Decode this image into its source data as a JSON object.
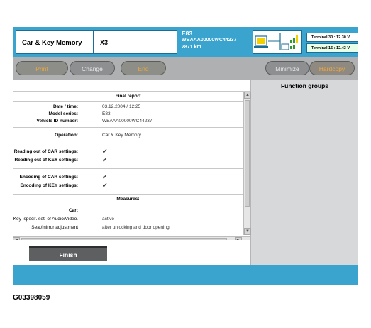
{
  "header": {
    "app_title": "Car & Key Memory",
    "model": "X3",
    "vehicle_series": "E83",
    "vin": "WBAAA00000WC44237",
    "mileage": "2871 km",
    "terminal_30": "Terminal 30 : 12.30 V",
    "terminal_15": "Terminal 15 : 12.43 V"
  },
  "toolbar": {
    "print": "Print",
    "change": "Change",
    "end": "End",
    "minimize": "Minimize",
    "hardcopy": "Hardcopy"
  },
  "function_groups": {
    "title": "Function groups"
  },
  "report": {
    "title": "Final report",
    "info": [
      {
        "label": "Date / time:",
        "value": "03.12.2004 / 12:25"
      },
      {
        "label": "Model series:",
        "value": "E83"
      },
      {
        "label": "Vehicle ID number:",
        "value": "WBAAA00000WC44237"
      }
    ],
    "operation": {
      "label": "Operation:",
      "value": "Car & Key Memory"
    },
    "reading": [
      {
        "label": "Reading out of CAR settings:",
        "value": "✔"
      },
      {
        "label": "Reading out of KEY settings:",
        "value": "✔"
      }
    ],
    "encoding": [
      {
        "label": "Encoding of CAR settings:",
        "value": "✔"
      },
      {
        "label": "Encoding of KEY settings:",
        "value": "✔"
      }
    ],
    "measures_title": "Measures:",
    "measures": [
      {
        "label": "Car:",
        "value": ""
      },
      {
        "label": "Key–specif. set. of Audio/Video.",
        "value": "active"
      },
      {
        "label": "Seat/mirror adjustment",
        "value": "after unlocking and door opening"
      }
    ]
  },
  "finish_label": "Finish",
  "figure_code": "G03398059",
  "colors": {
    "header_blue": "#3aa4cf",
    "toolbar_grey": "#aeb0b2",
    "button_gold_text": "#e6a640",
    "check_green": "#2e9a2e"
  }
}
